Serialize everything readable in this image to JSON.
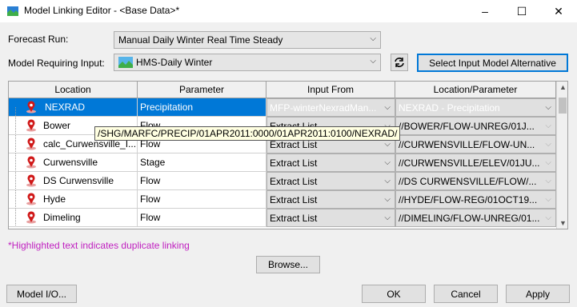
{
  "window": {
    "title": "Model Linking Editor - <Base Data>*",
    "minimize": "–",
    "maximize": "☐",
    "close": "✕"
  },
  "form": {
    "forecast_run_label": "Forecast Run:",
    "forecast_run_value": "Manual Daily Winter Real Time Steady",
    "model_input_label": "Model Requiring Input:",
    "model_input_value": "HMS-Daily Winter",
    "select_alt_button": "Select Input Model Alternative"
  },
  "table": {
    "headers": [
      "Location",
      "Parameter",
      "Input From",
      "Location/Parameter"
    ],
    "rows": [
      {
        "location": "NEXRAD",
        "parameter": "Precipitation",
        "input_from": "MFP-winterNexradMan...",
        "loc_param": "NEXRAD - Precipitation"
      },
      {
        "location": "Bower",
        "parameter": "Flow",
        "input_from": "Extract List",
        "loc_param": "//BOWER/FLOW-UNREG/01J..."
      },
      {
        "location": "calc_Curwensville_I...",
        "parameter": "Flow",
        "input_from": "Extract List",
        "loc_param": "//CURWENSVILLE/FLOW-UN..."
      },
      {
        "location": "Curwensville",
        "parameter": "Stage",
        "input_from": "Extract List",
        "loc_param": "//CURWENSVILLE/ELEV/01JU..."
      },
      {
        "location": "DS Curwensville",
        "parameter": "Flow",
        "input_from": "Extract List",
        "loc_param": "//DS CURWENSVILLE/FLOW/..."
      },
      {
        "location": "Hyde",
        "parameter": "Flow",
        "input_from": "Extract List",
        "loc_param": "//HYDE/FLOW-REG/01OCT19..."
      },
      {
        "location": "Dimeling",
        "parameter": "Flow",
        "input_from": "Extract List",
        "loc_param": "//DIMELING/FLOW-UNREG/01..."
      }
    ]
  },
  "tooltip": "/SHG/MARFC/PRECIP/01APR2011:0000/01APR2011:0100/NEXRAD/",
  "note": "*Highlighted text indicates duplicate linking",
  "buttons": {
    "browse": "Browse...",
    "model_io": "Model I/O...",
    "ok": "OK",
    "cancel": "Cancel",
    "apply": "Apply"
  }
}
